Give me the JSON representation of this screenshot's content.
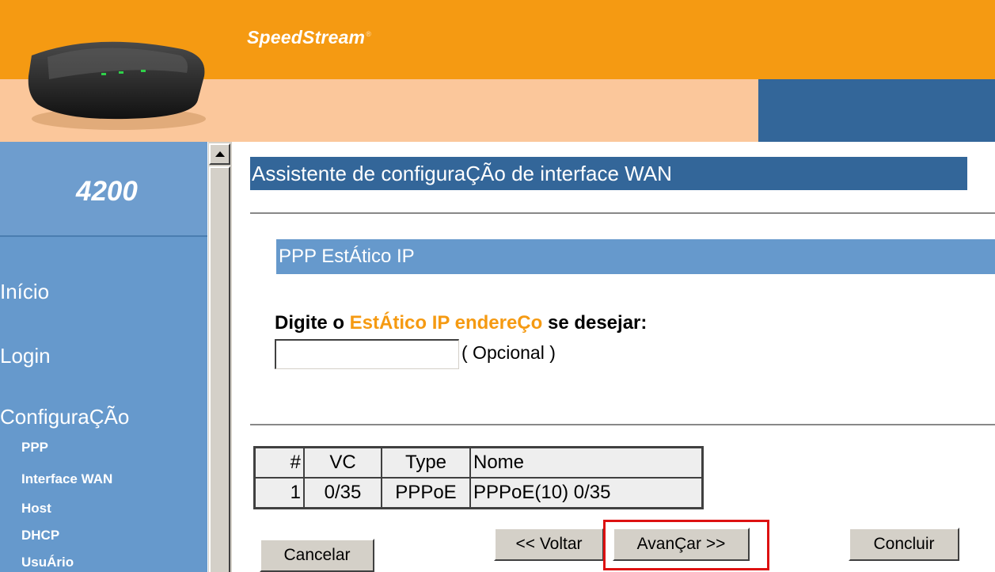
{
  "header": {
    "brand": "SpeedStream",
    "brand_mark": "®"
  },
  "sidebar": {
    "model": "4200",
    "main_items": [
      {
        "label": "Início"
      },
      {
        "label": "Login"
      },
      {
        "label": "ConfiguraÇÃo"
      }
    ],
    "sub_items": [
      {
        "label": "PPP"
      },
      {
        "label": "Interface WAN"
      },
      {
        "label": "Host"
      },
      {
        "label": "DHCP"
      },
      {
        "label": "UsuÁrio"
      }
    ]
  },
  "main": {
    "title": "Assistente de configuraÇÃo de interface WAN",
    "section_title": "PPP EstÁtico IP",
    "prompt": {
      "before": "Digite o ",
      "highlight": "EstÁtico IP endereÇo",
      "after": " se desejar:"
    },
    "ip_field": {
      "value": "",
      "placeholder": ""
    },
    "optional_label": "( Opcional )",
    "table": {
      "headers": [
        "#",
        "VC",
        "Type",
        "Nome"
      ],
      "rows": [
        [
          "1",
          "0/35",
          "PPPoE",
          "PPPoE(10) 0/35"
        ]
      ]
    },
    "buttons": {
      "cancel": "Cancelar",
      "back": "<< Voltar",
      "next": "AvanÇar >>",
      "finish": "Concluir"
    }
  },
  "colors": {
    "header_orange": "#f59a12",
    "header_peach": "#fbc79b",
    "dark_blue": "#336699",
    "light_blue": "#6699cc",
    "highlight_red": "#dd1111"
  }
}
